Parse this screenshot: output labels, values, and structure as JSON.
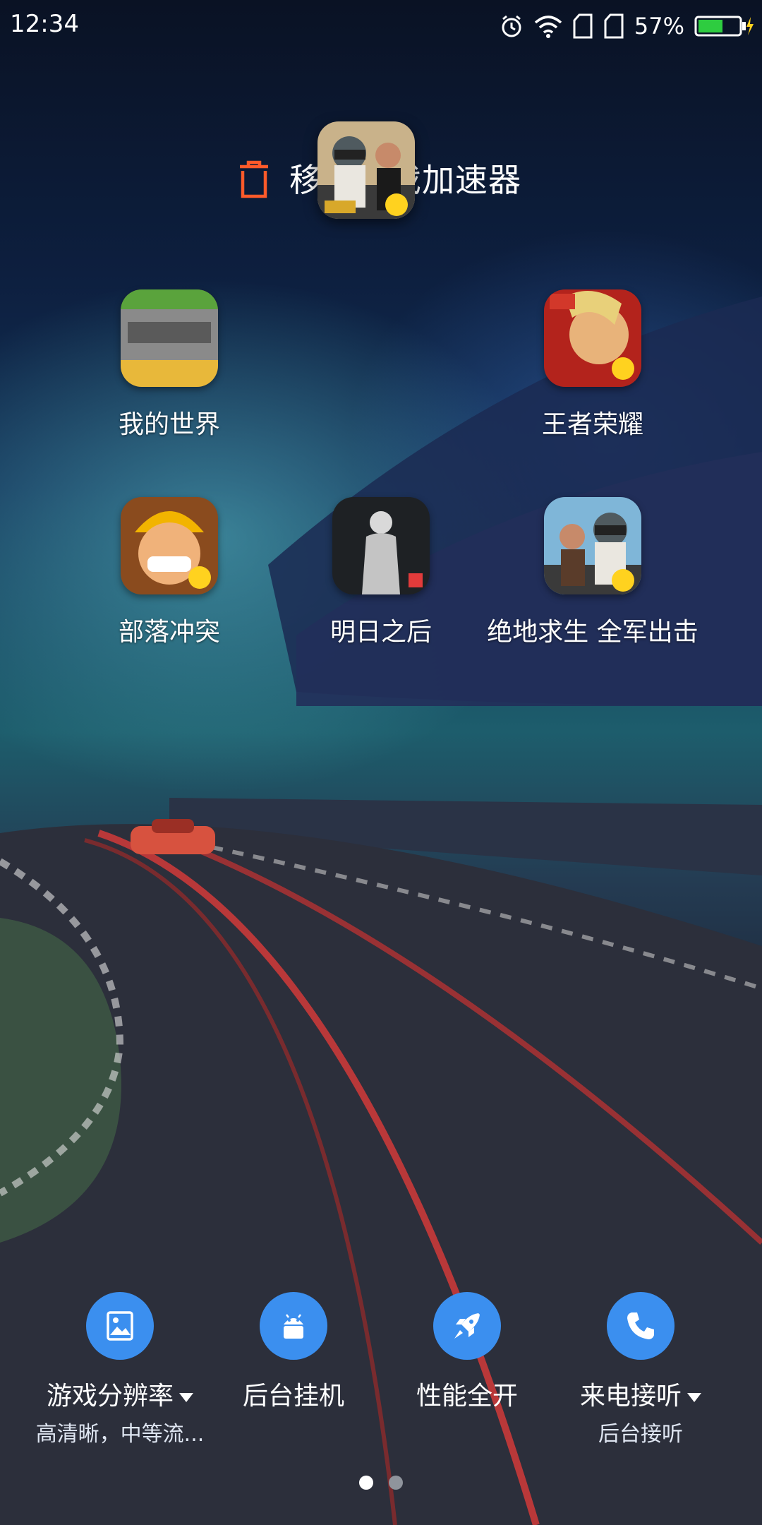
{
  "status_bar": {
    "time": "12:34",
    "battery_percent": "57%",
    "icons": [
      "alarm-icon",
      "wifi-icon",
      "sim1-icon",
      "sim2-icon",
      "battery-charging-icon"
    ]
  },
  "drop_target": {
    "label": "移出游戏加速器",
    "icon": "trash-icon",
    "dragging_app": "绝地求生 全军出击"
  },
  "apps": [
    {
      "name": "我的世界",
      "icon": "minecraft-icon"
    },
    {
      "name": "王者荣耀",
      "icon": "honor-of-kings-icon"
    },
    {
      "name": "部落冲突",
      "icon": "clash-of-clans-icon"
    },
    {
      "name": "明日之后",
      "icon": "lifeafter-icon"
    },
    {
      "name": "绝地求生 全军出击",
      "icon": "pubg-icon"
    }
  ],
  "toolbar": [
    {
      "label": "游戏分辨率",
      "sub": "高清晰，中等流...",
      "icon": "image-icon",
      "has_dropdown": true
    },
    {
      "label": "后台挂机",
      "sub": "",
      "icon": "android-icon",
      "has_dropdown": false
    },
    {
      "label": "性能全开",
      "sub": "",
      "icon": "rocket-icon",
      "has_dropdown": false
    },
    {
      "label": "来电接听",
      "sub": "后台接听",
      "icon": "phone-icon",
      "has_dropdown": true
    }
  ],
  "pager": {
    "pages": 2,
    "current": 1
  },
  "colors": {
    "accent": "#3b8fef",
    "trash": "#ff5a2a",
    "battery": "#2ecc40"
  }
}
